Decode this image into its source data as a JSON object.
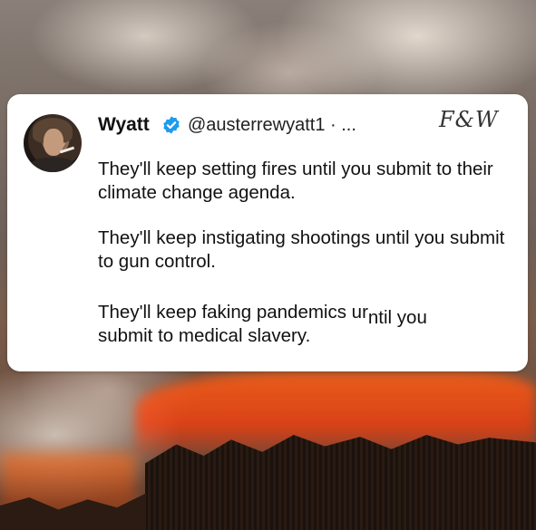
{
  "tweet": {
    "name": "Wyatt",
    "handle": "@austerrewyatt1 · ...",
    "watermark": "F&W",
    "paragraphs": [
      "They'll keep setting fires until you submit to their climate change agenda.",
      "They'll keep instigating shootings until you submit to gun control."
    ],
    "p3_part1": "They'll keep faking pandemics ur",
    "p3_part2": "ntil you",
    "p3_line2": "submit to medical slavery."
  },
  "colors": {
    "verified_badge": "#1d9bf0",
    "card_bg": "#ffffff",
    "fire": "#ff5a14"
  },
  "icons": {
    "verified": "verified-badge-icon"
  }
}
